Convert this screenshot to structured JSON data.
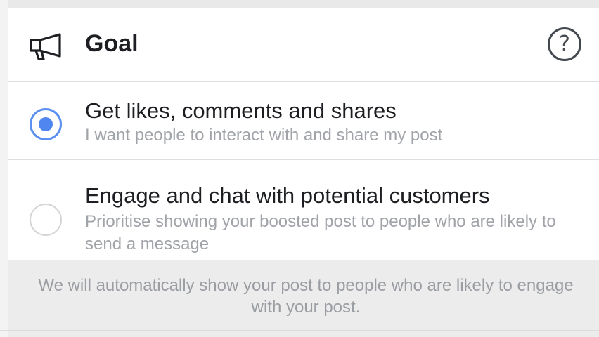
{
  "header": {
    "icon": "megaphone-icon",
    "title": "Goal",
    "help_icon": "question-circle-icon",
    "help_glyph": "?"
  },
  "options": [
    {
      "title": "Get likes, comments and shares",
      "description": "I want people to interact with and share my post",
      "selected": true
    },
    {
      "title": "Engage and chat with potential customers",
      "description": "Prioritise showing your boosted post to people who are likely to send a message",
      "selected": false
    }
  ],
  "footer": {
    "note": "We will automatically show your post to people who are likely to engage with your post."
  },
  "colors": {
    "accent": "#4f86ef",
    "text_primary": "#1c1e21",
    "text_secondary": "#a0a3a8",
    "background": "#ececec"
  }
}
